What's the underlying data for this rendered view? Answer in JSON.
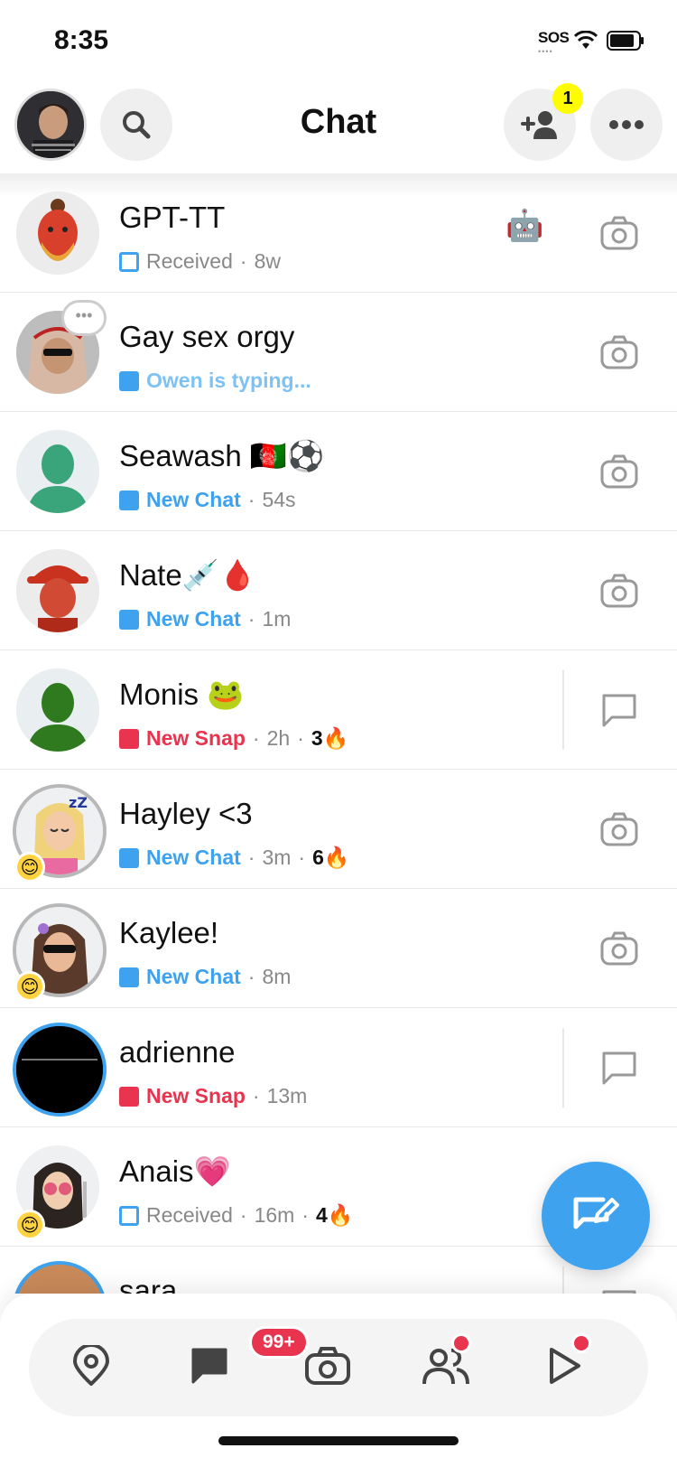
{
  "status_bar": {
    "time": "8:35",
    "sos": "SOS"
  },
  "header": {
    "title": "Chat",
    "add_friend_badge": "1"
  },
  "chats": [
    {
      "name": "GPT-TT",
      "status": "Received",
      "time": "8w",
      "extra": "🤖",
      "streak": "",
      "action": "camera"
    },
    {
      "name": "Gay sex orgy",
      "status": "Owen is typing...",
      "time": "",
      "extra": "",
      "streak": "",
      "action": "camera"
    },
    {
      "name": "Seawash 🇦🇫⚽",
      "status": "New Chat",
      "time": "54s",
      "extra": "",
      "streak": "",
      "action": "camera"
    },
    {
      "name": "Nate💉🩸",
      "status": "New Chat",
      "time": "1m",
      "extra": "",
      "streak": "",
      "action": "camera"
    },
    {
      "name": "Monis 🐸",
      "status": "New Snap",
      "time": "2h",
      "extra": "",
      "streak": "3🔥",
      "action": "chat"
    },
    {
      "name": "Hayley <3",
      "status": "New Chat",
      "time": "3m",
      "extra": "",
      "streak": "6🔥",
      "action": "camera"
    },
    {
      "name": "Kaylee!",
      "status": "New Chat",
      "time": "8m",
      "extra": "",
      "streak": "",
      "action": "camera"
    },
    {
      "name": "adrienne",
      "status": "New Snap",
      "time": "13m",
      "extra": "",
      "streak": "",
      "action": "chat"
    },
    {
      "name": "Anais💗",
      "status": "Received",
      "time": "16m",
      "extra": "",
      "streak": "4🔥",
      "action": "camera"
    },
    {
      "name": "sara",
      "status": "",
      "time": "",
      "extra": "",
      "streak": "",
      "action": "chat"
    }
  ],
  "nav": {
    "chat_badge": "99+"
  },
  "colors": {
    "blue": "#3ea2ee",
    "red": "#e8344f",
    "yellow": "#fffc00"
  },
  "icons": [
    "search-icon",
    "add-friend-icon",
    "more-icon",
    "camera-icon",
    "chat-icon",
    "map-pin-icon",
    "friends-icon",
    "play-icon",
    "compose-icon",
    "robot-icon"
  ]
}
